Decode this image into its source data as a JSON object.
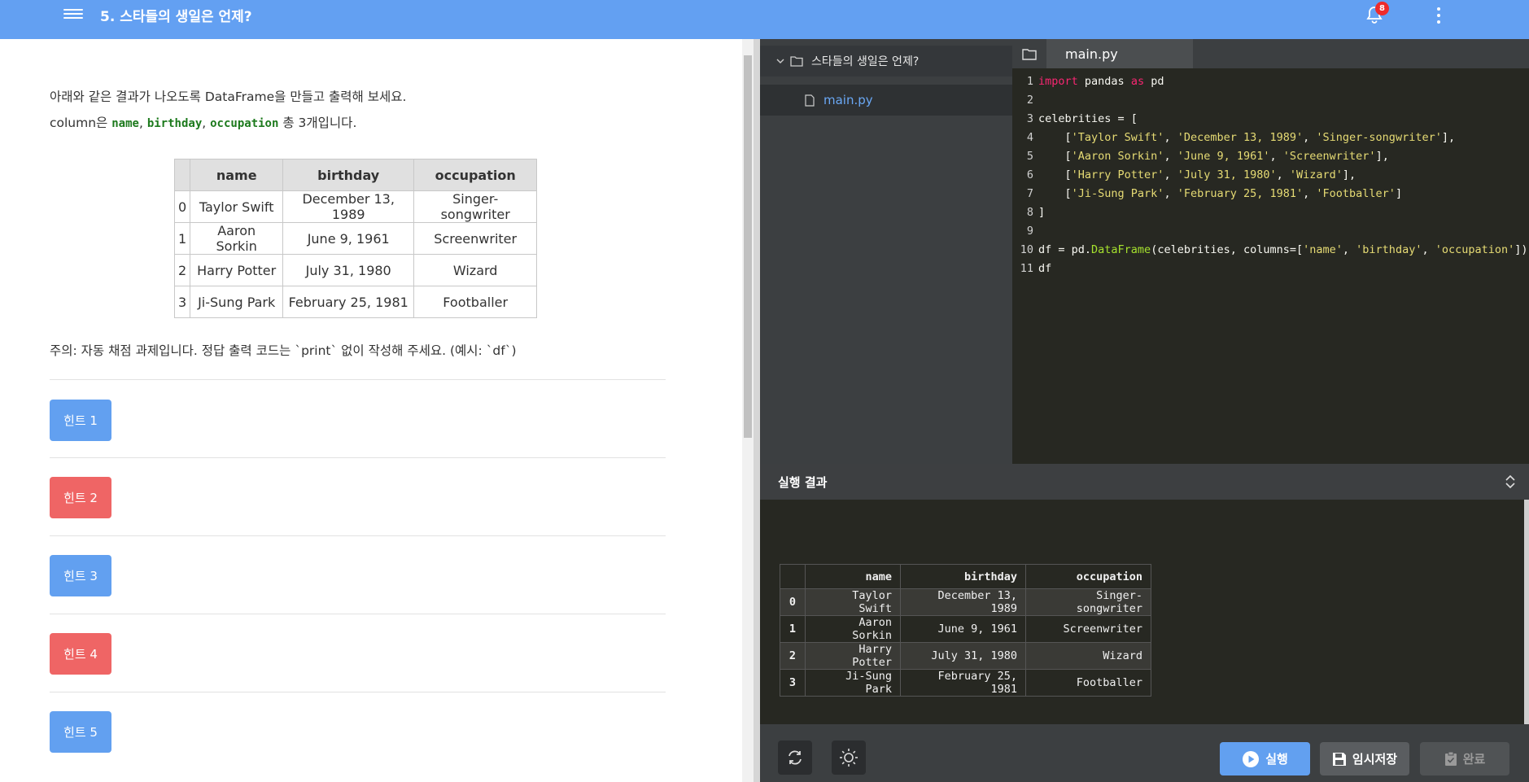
{
  "header": {
    "title": "5. 스타들의 생일은 언제?",
    "notification_count": "8"
  },
  "instructions": {
    "line1": "아래와 같은 결과가 나오도록 DataFrame을 만들고 출력해 보세요.",
    "line2_prefix": "column은 ",
    "col1": "name",
    "sep1": ", ",
    "col2": "birthday",
    "sep2": ", ",
    "col3": "occupation",
    "line2_suffix": " 총 3개입니다."
  },
  "question_table": {
    "headers": [
      "",
      "name",
      "birthday",
      "occupation"
    ],
    "rows": [
      [
        "0",
        "Taylor Swift",
        "December 13, 1989",
        "Singer-songwriter"
      ],
      [
        "1",
        "Aaron Sorkin",
        "June 9, 1961",
        "Screenwriter"
      ],
      [
        "2",
        "Harry Potter",
        "July 31, 1980",
        "Wizard"
      ],
      [
        "3",
        "Ji-Sung Park",
        "February 25, 1981",
        "Footballer"
      ]
    ]
  },
  "note": "주의: 자동 채점 과제입니다. 정답 출력 코드는 `print` 없이 작성해 주세요. (예시: `df`)",
  "hints": [
    {
      "label": "힌트 1",
      "color": "blue"
    },
    {
      "label": "힌트 2",
      "color": "red"
    },
    {
      "label": "힌트 3",
      "color": "blue"
    },
    {
      "label": "힌트 4",
      "color": "red"
    },
    {
      "label": "힌트 5",
      "color": "blue"
    }
  ],
  "file_tree": {
    "folder": "스타들의 생일은 언제?",
    "file": "main.py"
  },
  "editor": {
    "tab": "main.py",
    "line_numbers": [
      "1",
      "2",
      "3",
      "4",
      "5",
      "6",
      "7",
      "8",
      "9",
      "10",
      "11"
    ],
    "code": {
      "l1_import": "import",
      "l1_pandas": " pandas ",
      "l1_as": "as",
      "l1_pd": " pd",
      "l3": "celebrities = [",
      "l4_open": "    [",
      "l4_a": "'Taylor Swift'",
      "l4_b": "'December 13, 1989'",
      "l4_c": "'Singer-songwriter'",
      "l4_close": "],",
      "l5_open": "    [",
      "l5_a": "'Aaron Sorkin'",
      "l5_b": "'June 9, 1961'",
      "l5_c": "'Screenwriter'",
      "l5_close": "],",
      "l6_open": "    [",
      "l6_a": "'Harry Potter'",
      "l6_b": "'July 31, 1980'",
      "l6_c": "'Wizard'",
      "l6_close": "],",
      "l7_open": "    [",
      "l7_a": "'Ji-Sung Park'",
      "l7_b": "'February 25, 1981'",
      "l7_c": "'Footballer'",
      "l7_close": "]",
      "l8": "]",
      "l10_a": "df = pd.",
      "l10_fn": "DataFrame",
      "l10_b": "(celebrities, columns=[",
      "l10_c1": "'name'",
      "l10_c2": "'birthday'",
      "l10_c3": "'occupation'",
      "l10_end": "])",
      "l11": "df",
      "comma": ", "
    }
  },
  "output": {
    "title": "실행 결과",
    "headers": [
      "",
      "name",
      "birthday",
      "occupation"
    ],
    "rows": [
      [
        "0",
        "Taylor Swift",
        "December 13, 1989",
        "Singer-songwriter"
      ],
      [
        "1",
        "Aaron Sorkin",
        "June 9, 1961",
        "Screenwriter"
      ],
      [
        "2",
        "Harry Potter",
        "July 31, 1980",
        "Wizard"
      ],
      [
        "3",
        "Ji-Sung Park",
        "February 25, 1981",
        "Footballer"
      ]
    ]
  },
  "footer": {
    "run_label": "실행",
    "save_label": "임시저장",
    "done_label": "완료"
  },
  "colors": {
    "header_blue": "#63a0f2",
    "hint_blue": "#62a0f0",
    "hint_red": "#ef6565",
    "editor_bg": "#272822"
  }
}
